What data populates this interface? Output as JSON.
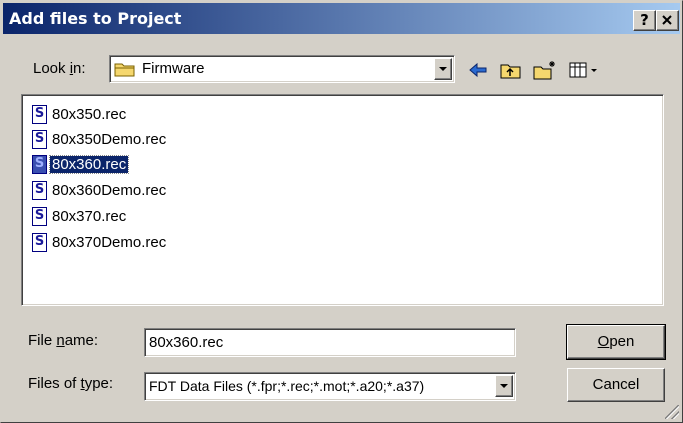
{
  "window": {
    "title": "Add files to Project",
    "help_label": "?",
    "close_label": "✕"
  },
  "lookin": {
    "label_pre": "Look ",
    "label_u": "i",
    "label_post": "n:",
    "value": "Firmware"
  },
  "toolbar": {
    "back_icon": "back-arrow-icon",
    "up_icon": "up-folder-icon",
    "new_icon": "new-folder-icon",
    "view_icon": "view-menu-icon"
  },
  "files": [
    {
      "name": "80x350.rec",
      "selected": false
    },
    {
      "name": "80x350Demo.rec",
      "selected": false
    },
    {
      "name": "80x360.rec",
      "selected": true
    },
    {
      "name": "80x360Demo.rec",
      "selected": false
    },
    {
      "name": "80x370.rec",
      "selected": false
    },
    {
      "name": "80x370Demo.rec",
      "selected": false
    }
  ],
  "file_icon_glyph": "S",
  "filename": {
    "label_pre": "File ",
    "label_u": "n",
    "label_post": "ame:",
    "value": "80x360.rec"
  },
  "filetype": {
    "label_pre": "Files of ",
    "label_u": "t",
    "label_post": "ype:",
    "value": "FDT Data Files (*.fpr;*.rec;*.mot;*.a20;*.a37)"
  },
  "buttons": {
    "open_u": "O",
    "open_rest": "pen",
    "cancel": "Cancel"
  },
  "colors": {
    "title_start": "#0a246a",
    "title_end": "#a6caf0",
    "selection": "#0a246a",
    "folder": "#f5d76e"
  }
}
